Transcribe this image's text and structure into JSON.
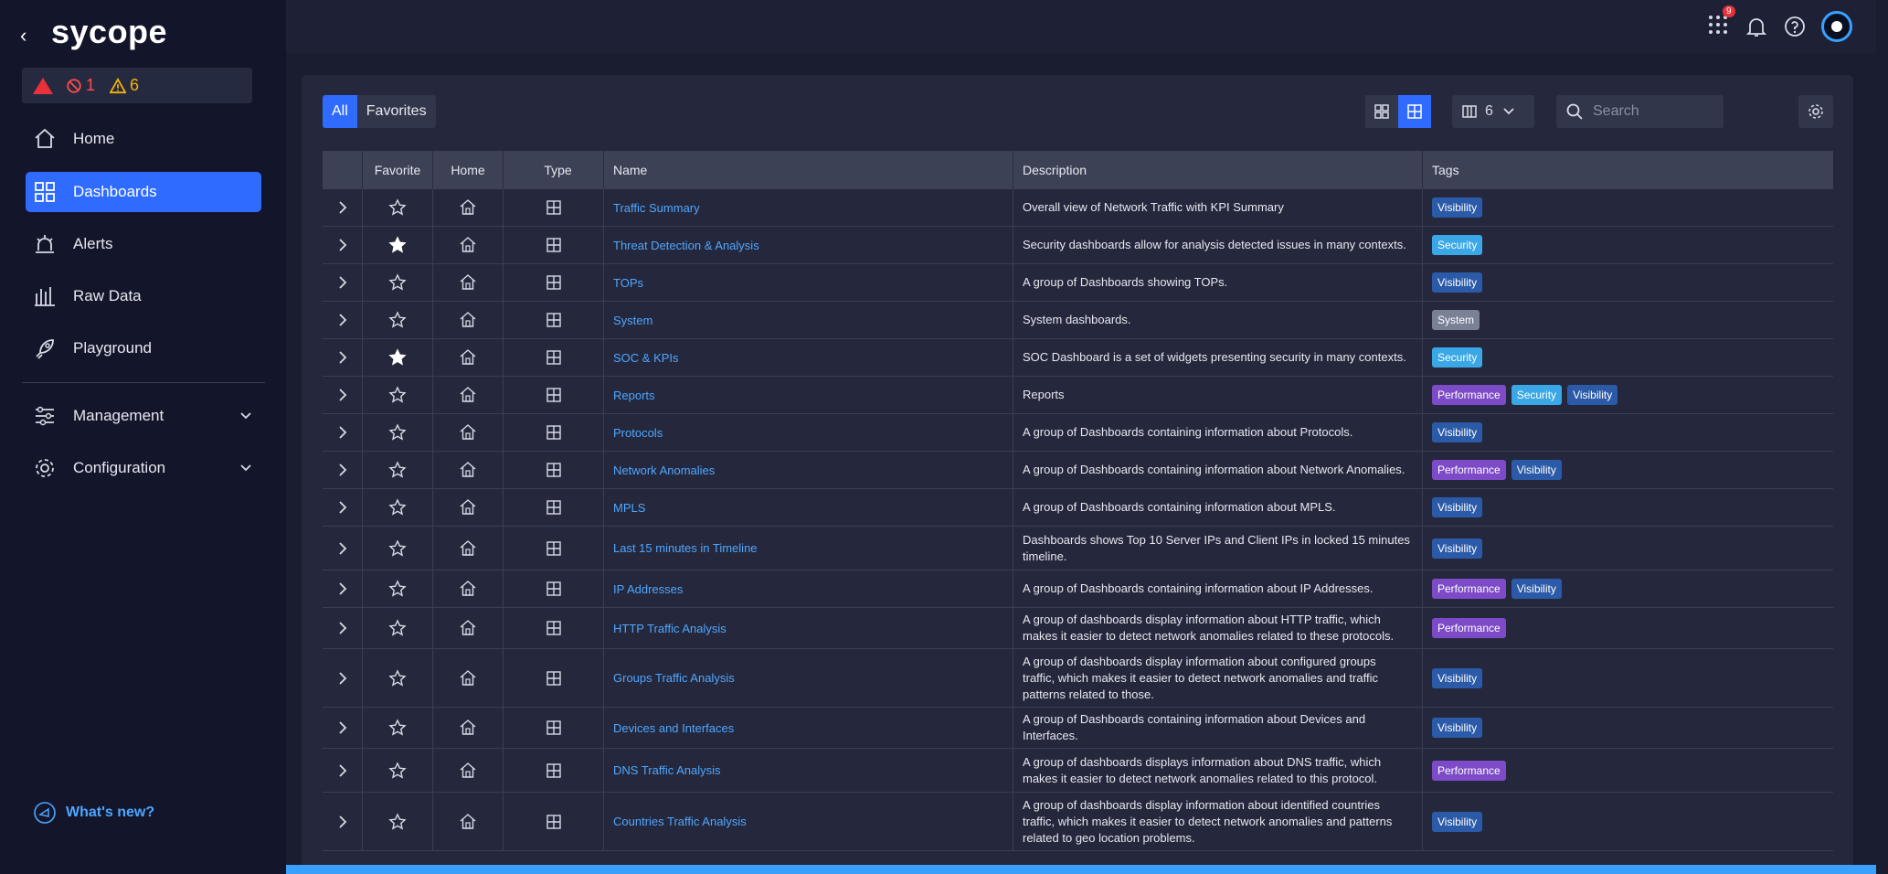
{
  "app": {
    "logo": "sycope"
  },
  "sidebar": {
    "alerts": {
      "errors": "1",
      "warnings": "6"
    },
    "items": [
      {
        "label": "Home",
        "icon": "home-icon"
      },
      {
        "label": "Dashboards",
        "icon": "dashboards-icon",
        "active": true
      },
      {
        "label": "Alerts",
        "icon": "alarm-icon"
      },
      {
        "label": "Raw Data",
        "icon": "bar-chart-icon"
      },
      {
        "label": "Playground",
        "icon": "rocket-icon"
      }
    ],
    "groups": [
      {
        "label": "Management",
        "icon": "sliders-icon"
      },
      {
        "label": "Configuration",
        "icon": "gear-icon"
      }
    ],
    "whats_new": "What's new?"
  },
  "topbar": {
    "notifications_count": "9"
  },
  "toolbar": {
    "tab_all": "All",
    "tab_favorites": "Favorites",
    "columns_count": "6",
    "search_placeholder": "Search"
  },
  "table": {
    "headers": {
      "favorite": "Favorite",
      "home": "Home",
      "type": "Type",
      "name": "Name",
      "description": "Description",
      "tags": "Tags"
    },
    "rows": [
      {
        "name": "Traffic Summary",
        "description": "Overall view of Network Traffic with KPI Summary",
        "favorite": false,
        "tags": [
          "Visibility"
        ]
      },
      {
        "name": "Threat Detection & Analysis",
        "description": "Security dashboards allow for analysis detected issues in many contexts.",
        "favorite": true,
        "tags": [
          "Security"
        ]
      },
      {
        "name": "TOPs",
        "description": "A group of Dashboards showing TOPs.",
        "favorite": false,
        "tags": [
          "Visibility"
        ]
      },
      {
        "name": "System",
        "description": "System dashboards.",
        "favorite": false,
        "tags": [
          "System"
        ]
      },
      {
        "name": "SOC & KPIs",
        "description": "SOC Dashboard is a set of widgets presenting security in many contexts.",
        "favorite": true,
        "tags": [
          "Security"
        ]
      },
      {
        "name": "Reports",
        "description": "Reports",
        "favorite": false,
        "tags": [
          "Performance",
          "Security",
          "Visibility"
        ]
      },
      {
        "name": "Protocols",
        "description": "A group of Dashboards containing information about Protocols.",
        "favorite": false,
        "tags": [
          "Visibility"
        ]
      },
      {
        "name": "Network Anomalies",
        "description": "A group of Dashboards containing information about Network Anomalies.",
        "favorite": false,
        "tags": [
          "Performance",
          "Visibility"
        ]
      },
      {
        "name": "MPLS",
        "description": "A group of Dashboards containing information about MPLS.",
        "favorite": false,
        "tags": [
          "Visibility"
        ]
      },
      {
        "name": "Last 15 minutes in Timeline",
        "description": "Dashboards shows Top 10 Server IPs and Client IPs in locked 15 minutes timeline.",
        "favorite": false,
        "tags": [
          "Visibility"
        ]
      },
      {
        "name": "IP Addresses",
        "description": "A group of Dashboards containing information about IP Addresses.",
        "favorite": false,
        "tags": [
          "Performance",
          "Visibility"
        ]
      },
      {
        "name": "HTTP Traffic Analysis",
        "description": "A group of dashboards display information about HTTP traffic, which makes it easier to detect network anomalies related to these protocols.",
        "favorite": false,
        "tags": [
          "Performance"
        ]
      },
      {
        "name": "Groups Traffic Analysis",
        "description": "A group of dashboards display information about configured groups traffic, which makes it easier to detect network anomalies and traffic patterns related to those.",
        "favorite": false,
        "tags": [
          "Visibility"
        ]
      },
      {
        "name": "Devices and Interfaces",
        "description": "A group of Dashboards containing information about Devices and Interfaces.",
        "favorite": false,
        "tags": [
          "Visibility"
        ]
      },
      {
        "name": "DNS Traffic Analysis",
        "description": "A group of dashboards displays information about DNS traffic, which makes it easier to detect network anomalies related to this protocol.",
        "favorite": false,
        "tags": [
          "Performance"
        ]
      },
      {
        "name": "Countries Traffic Analysis",
        "description": "A group of dashboards display information about identified countries traffic, which makes it easier to detect network anomalies and patterns related to geo location problems.",
        "favorite": false,
        "tags": [
          "Visibility"
        ]
      }
    ]
  },
  "colors": {
    "accent": "#2f6bff",
    "link": "#4ea6ff",
    "bg": "#1a1d30",
    "sidebar": "#13162a"
  }
}
